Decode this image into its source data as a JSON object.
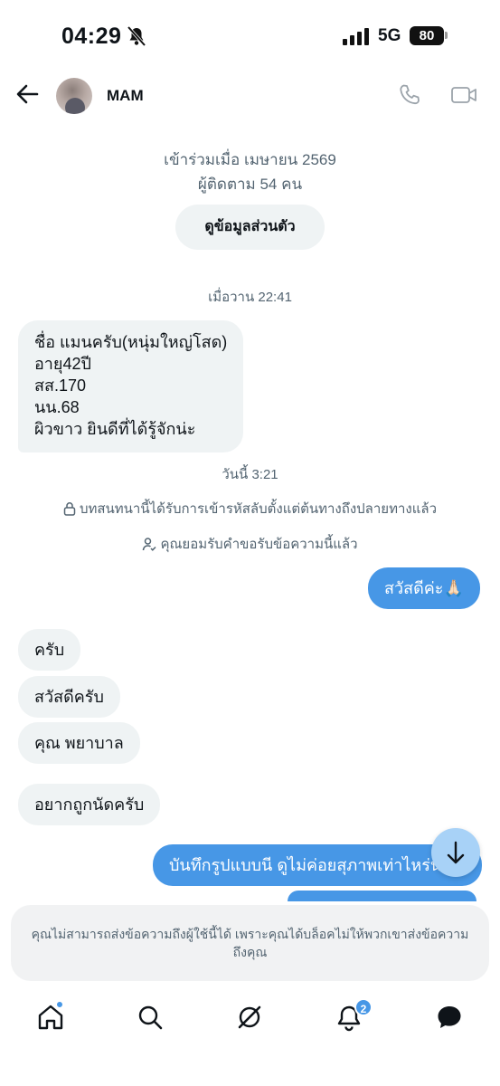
{
  "status_bar": {
    "time": "04:29",
    "network": "5G",
    "battery": "80"
  },
  "header": {
    "contact_name": "MAM"
  },
  "profile": {
    "joined": "เข้าร่วมเมื่อ เมษายน 2569",
    "followers": "ผู้ติดตาม 54 คน",
    "view_profile_label": "ดูข้อมูลส่วนตัว"
  },
  "messages": {
    "timestamp_1": "เมื่อวาน 22:41",
    "intro_lines": [
      "ชื่อ แมนครับ(หนุ่มใหญ่โสด)",
      "อายุ42ปี",
      "สส.170",
      "นน.68",
      "ผิวขาว ยินดีที่ได้รู้จักน่ะ"
    ],
    "timestamp_2": "วันนี้ 3:21",
    "encryption_notice": "บทสนทนานี้ได้รับการเข้ารหัสลับตั้งแต่ต้นทางถึงปลายทางแล้ว",
    "accepted_notice": "คุณยอมรับคำขอรับข้อความนี้แล้ว",
    "out_1": "สวัสดีค่ะ🙏🏻",
    "in_1": "ครับ",
    "in_2": "สวัสดีครับ",
    "in_3": "คุณ พยาบาล",
    "in_4": "อยากถูกนัดครับ",
    "out_2": "บันทึกรูปแบบนี ดูไม่ค่อยสุภาพเท่าไหร่น"
  },
  "blocked_notice": "คุณไม่สามารถส่งข้อความถึงผู้ใช้นี้ได้ เพราะคุณได้บล็อคไม่ให้พวกเขาส่งข้อความถึงคุณ",
  "bottom_nav": {
    "notifications_count": "2",
    "accent_color": "#4797e6"
  }
}
